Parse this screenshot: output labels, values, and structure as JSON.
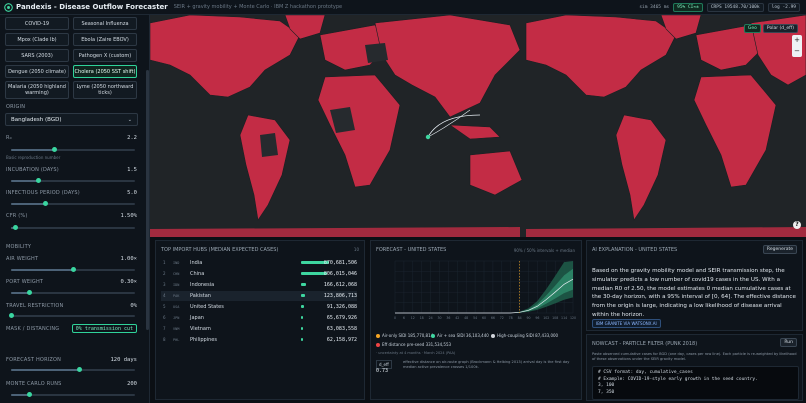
{
  "header": {
    "title": "Pandexis - Disease Outflow Forecaster",
    "subtitle": "SEIR + gravity mobility + Monte Carlo · IBM Z hackathon prototype",
    "sim": "sim 3465 ms",
    "cov": "95% CI≈±",
    "crps": "CRPS 19548.70/100k",
    "log": "log -2.99"
  },
  "sidebar": {
    "diseases": [
      "COVID-19",
      "Seasonal Influenza",
      "Mpox (Clade Ib)",
      "Ebola (Zaire EBOV)",
      "SARS (2003)",
      "Pathogen X (custom)",
      "Dengue (2050 climate)",
      "Cholera (2050 SST shift)",
      "Malaria (2050 highland warming)",
      "Lyme (2050 northward ticks)"
    ],
    "active_disease_index": 7,
    "origin_label": "ORIGIN",
    "origin_value": "Bangladesh (BGD)",
    "r0_label": "R₀",
    "r0_value": "2.2",
    "r0_hint": "Basic reproduction number",
    "incubation_label": "INCUBATION (DAYS)",
    "incubation_value": "1.5",
    "infectious_label": "INFECTIOUS PERIOD (DAYS)",
    "infectious_value": "5.0",
    "cfr_label": "CFR (%)",
    "cfr_value": "1.50%",
    "mobility_label": "MOBILITY",
    "air_label": "AIR WEIGHT",
    "air_value": "1.00×",
    "port_label": "PORT WEIGHT",
    "port_value": "0.30×",
    "travel_label": "TRAVEL RESTRICTION",
    "travel_value": "0%",
    "mask_label": "MASK / DISTANCING",
    "mask_value": "0% transmission cut",
    "horizon_label": "FORECAST HORIZON",
    "horizon_value": "120 days",
    "mc_label": "MONTE CARLO RUNS",
    "mc_value": "200",
    "sliders": {
      "r0": 0.35,
      "incubation": 0.22,
      "infectious": 0.28,
      "cfr": 0.04,
      "air": 0.5,
      "port": 0.15,
      "travel": 0.0,
      "horizon": 0.55,
      "mc": 0.15
    }
  },
  "map": {
    "geo_label": "Geo",
    "polar_label": "Polar (d_eff)",
    "zoom_in": "+",
    "zoom_out": "−",
    "help": "?"
  },
  "hubs": {
    "title": "TOP IMPORT HUBS (MEDIAN EXPECTED CASES)",
    "corner": "10",
    "rows": [
      {
        "n": "1",
        "code": "IND",
        "name": "India",
        "value": "870,681,506",
        "frac": 1.0
      },
      {
        "n": "2",
        "code": "CHN",
        "name": "China",
        "value": "806,015,046",
        "frac": 0.93
      },
      {
        "n": "3",
        "code": "IDN",
        "name": "Indonesia",
        "value": "166,612,068",
        "frac": 0.19
      },
      {
        "n": "4",
        "code": "PAK",
        "name": "Pakistan",
        "value": "123,806,713",
        "frac": 0.14
      },
      {
        "n": "5",
        "code": "USA",
        "name": "United States",
        "value": "91,326,088",
        "frac": 0.11
      },
      {
        "n": "6",
        "code": "JPN",
        "name": "Japan",
        "value": "65,679,926",
        "frac": 0.08
      },
      {
        "n": "7",
        "code": "VNM",
        "name": "Vietnam",
        "value": "63,083,558",
        "frac": 0.07
      },
      {
        "n": "8",
        "code": "PHL",
        "name": "Philippines",
        "value": "62,158,972",
        "frac": 0.07
      }
    ]
  },
  "forecast": {
    "title": "FORECAST - UNITED STATES",
    "legend": "90% / 50% intervals + median",
    "x_ticks": [
      "0",
      "6",
      "12",
      "18",
      "24",
      "30",
      "36",
      "42",
      "48",
      "54",
      "60",
      "66",
      "72",
      "78",
      "84",
      "90",
      "96",
      "102",
      "108",
      "114",
      "120"
    ],
    "items": [
      {
        "label": "Air-only SIDI 185,770,814",
        "color": "#f5a524"
      },
      {
        "label": "Air + sea SIDI 36,103,440",
        "color": "#3ed6a0"
      },
      {
        "label": "High-coupling SIDI 87,433,000",
        "color": "#d1d5db"
      },
      {
        "label": "Eff distance pre-seed 331,534,553",
        "color": "#ef4444"
      }
    ],
    "note_small": "· uncertainty at 4 months · March 2024 (PAA)",
    "deff_label": "d_eff",
    "deff_value": "0.73",
    "deff_desc": "effective distance on air-route graph (Brockmann & Helbing 2013) arrival day is the first day median active prevalence crosses 1/100k.",
    "chart_data": {
      "type": "area",
      "x": [
        0,
        6,
        12,
        18,
        24,
        30,
        36,
        42,
        48,
        54,
        60,
        66,
        72,
        78,
        84,
        90,
        96,
        102,
        108,
        114,
        120
      ],
      "xlim": [
        0,
        120
      ],
      "series": [
        {
          "values": [
            0,
            0,
            0,
            0,
            0,
            0,
            0,
            0,
            0,
            0,
            0,
            0,
            0,
            0,
            0.02,
            0.08,
            0.2,
            0.4,
            0.62,
            0.85,
            1.0
          ]
        }
      ],
      "grid": true
    }
  },
  "ai": {
    "title": "AI EXPLANATION - UNITED STATES",
    "regen": "Regenerate",
    "text": "Based on the gravity mobility model and SEIR transmission step, the simulator predicts a low number of covid19 cases in the US. With a median R0 of 2.50, the model estimates 0 median cumulative cases at the 30-day horizon, with a 95% interval of [0, 64]. The effective distance from the origin is large, indicating a low likelihood of disease arrival within the horizon.",
    "tag": "IBM GRANITE VIA WATSONX.AI"
  },
  "nowcast": {
    "title": "NOWCAST - PARTICLE FILTER (PUNK 2018)",
    "run": "Run",
    "desc": "Paste observed cumulative cases for BGD (one day, cases per row line). Each particle is re-weighted by likelihood of these observations under the SEIR gravity model.",
    "code_lines": [
      "# CSV format: day, cumulative_cases",
      "# Example: COVID-19-style early growth in the seed country.",
      "3, 100",
      "7, 350"
    ]
  }
}
